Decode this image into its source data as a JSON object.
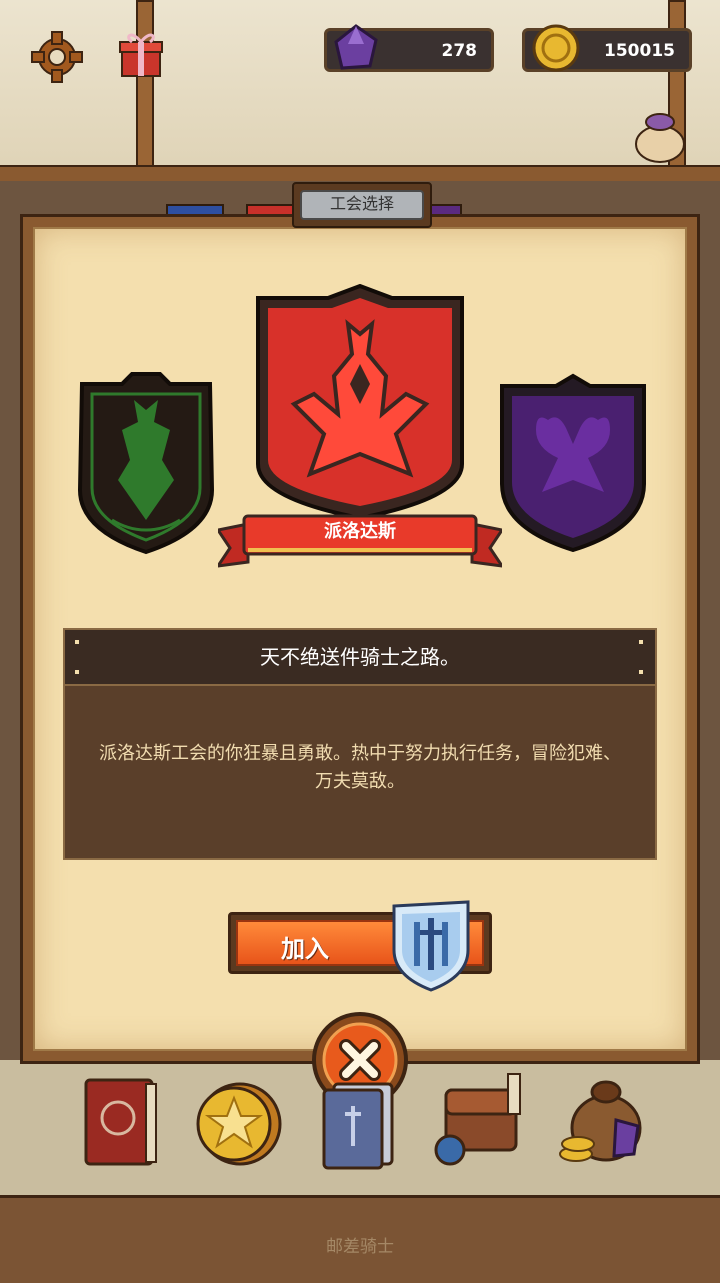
{
  "currencies": {
    "gems": "278",
    "coins": "150015"
  },
  "dialog": {
    "title": "工会选择",
    "selected_guild": "派洛达斯",
    "motto": "天不绝送件骑士之路。",
    "description": "派洛达斯工会的你狂暴且勇敢。热中于努力执行任务，冒险犯难、万夫莫敌。",
    "join_label": "加入"
  },
  "guild_colors": {
    "left": "#2f7a2c",
    "center": "#e83a2a",
    "right": "#5a2a80"
  },
  "footer": {
    "title": "邮差骑士"
  },
  "icons": [
    "gear-icon",
    "gift-icon",
    "gem-icon",
    "coin-icon",
    "loot-bag-icon",
    "shield-sword-icon",
    "close-icon",
    "spellbook-icon",
    "star-coin-icon",
    "card-deck-icon",
    "backpack-icon",
    "treasure-bag-icon"
  ]
}
